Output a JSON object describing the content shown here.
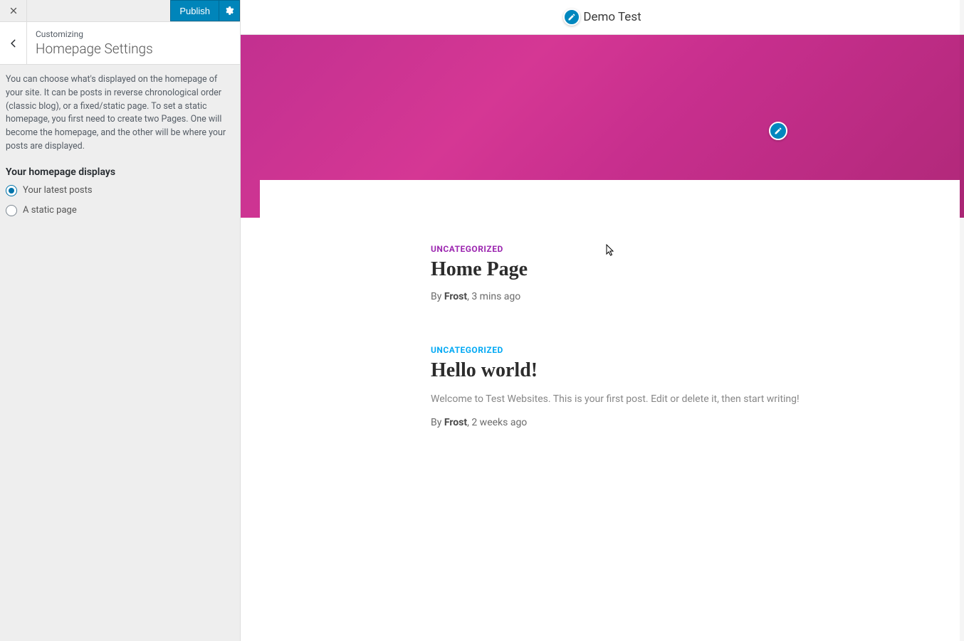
{
  "sidebar": {
    "publish_label": "Publish",
    "eyebrow": "Customizing",
    "title": "Homepage Settings",
    "description": "You can choose what's displayed on the homepage of your site. It can be posts in reverse chronological order (classic blog), or a fixed/static page. To set a static homepage, you first need to create two Pages. One will become the homepage, and the other will be where your posts are displayed.",
    "subheading": "Your homepage displays",
    "options": [
      {
        "label": "Your latest posts",
        "checked": true
      },
      {
        "label": "A static page",
        "checked": false
      }
    ]
  },
  "preview": {
    "site_title": "Demo Test",
    "posts": [
      {
        "category": "UNCATEGORIZED",
        "category_color": "c-pink",
        "title": "Home Page",
        "excerpt": "",
        "by_label": "By ",
        "author": "Frost",
        "separator": ", ",
        "time": "3 mins ago"
      },
      {
        "category": "UNCATEGORIZED",
        "category_color": "c-blue",
        "title": "Hello world!",
        "excerpt": "Welcome to Test Websites. This is your first post. Edit or delete it, then start writing!",
        "by_label": "By ",
        "author": "Frost",
        "separator": ", ",
        "time": "2 weeks ago"
      }
    ]
  }
}
